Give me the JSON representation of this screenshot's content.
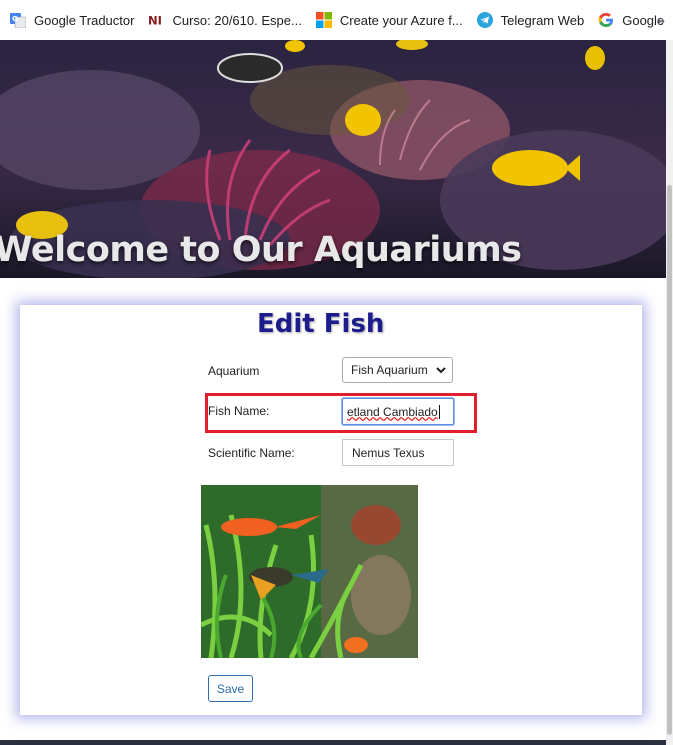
{
  "bookmarks": [
    {
      "label": "Google Traductor",
      "icon": "google-translate-icon"
    },
    {
      "label": "Curso: 20/610. Espe...",
      "icon": "ni-logo-icon"
    },
    {
      "label": "Create your Azure f...",
      "icon": "microsoft-logo-icon"
    },
    {
      "label": "Telegram Web",
      "icon": "telegram-icon"
    },
    {
      "label": "Google",
      "icon": "google-g-icon"
    }
  ],
  "bookmarks_more": "»",
  "hero": {
    "title": "Welcome to Our Aquariums"
  },
  "form": {
    "title": "Edit Fish",
    "aquarium_label": "Aquarium",
    "aquarium_value": "Fish Aquarium",
    "fish_name_label": "Fish Name:",
    "fish_name_value": "etland Cambiado",
    "scientific_name_label": "Scientific Name:",
    "scientific_name_value": "Nemus Texus",
    "save_label": "Save"
  },
  "colors": {
    "title": "#1c1c8c",
    "highlight": "#e01e2c",
    "button": "#2b6cb0"
  }
}
